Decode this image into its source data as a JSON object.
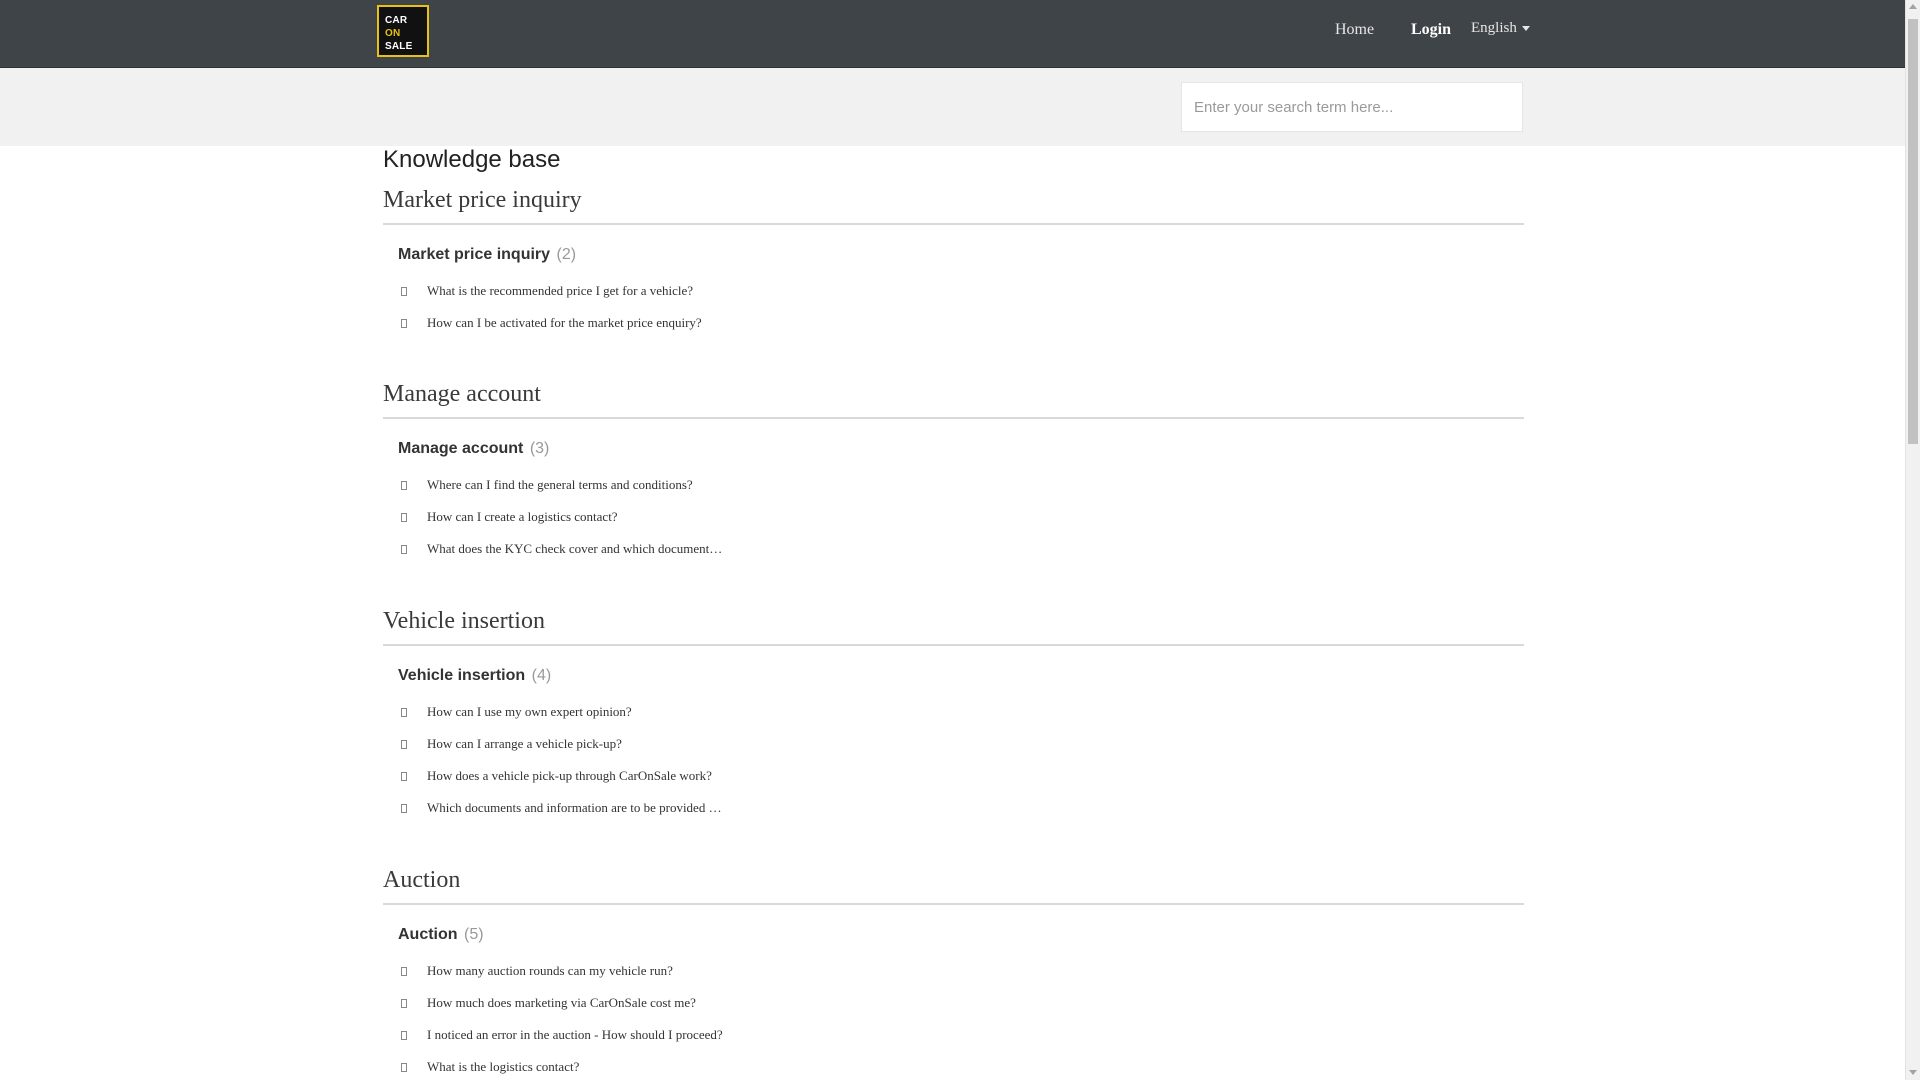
{
  "header": {
    "logo_lines": [
      "CAR",
      "ON",
      "SALE"
    ],
    "nav": {
      "home": "Home",
      "login": "Login",
      "language": "English"
    }
  },
  "search": {
    "placeholder": "Enter your search term here..."
  },
  "page": {
    "title": "Knowledge base"
  },
  "sections": [
    {
      "heading": "Market price inquiry",
      "category": "Market price inquiry",
      "count": "(2)",
      "articles": [
        "What is the recommended price I get for a vehicle?",
        "How can I be activated for the market price enquiry?"
      ]
    },
    {
      "heading": "Manage account",
      "category": "Manage account",
      "count": "(3)",
      "articles": [
        "Where can I find the general terms and conditions?",
        "How can I create a logistics contact?",
        "What does the KYC check cover and which document…"
      ]
    },
    {
      "heading": "Vehicle insertion",
      "category": "Vehicle insertion",
      "count": "(4)",
      "articles": [
        "How can I use my own expert opinion?",
        "How can I arrange a vehicle pick-up?",
        "How does a vehicle pick-up through CarOnSale work?",
        "Which documents and information are to be provided …"
      ]
    },
    {
      "heading": "Auction",
      "category": "Auction",
      "count": "(5)",
      "articles": [
        "How many auction rounds can my vehicle run?",
        "How much does marketing via CarOnSale cost me?",
        "I noticed an error in the auction - How should I proceed?",
        "What is the logistics contact?"
      ]
    }
  ]
}
